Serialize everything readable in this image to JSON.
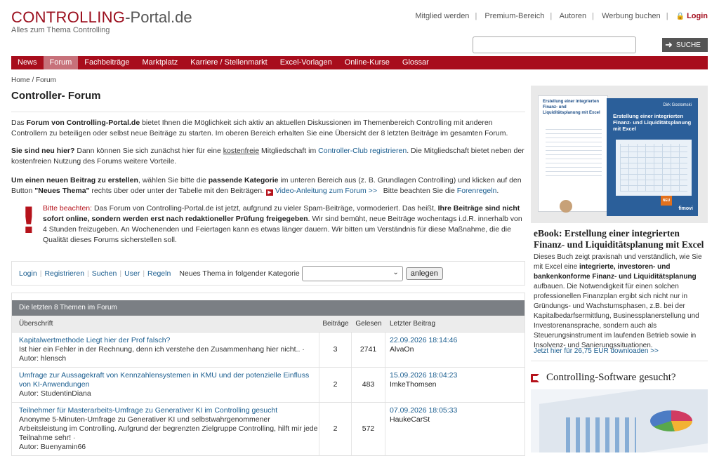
{
  "header": {
    "brand": "CONTROLLING",
    "brand_suffix": "-Portal.de",
    "tagline": "Alles zum Thema Controlling",
    "top_links": [
      "Mitglied werden",
      "Premium-Bereich",
      "Autoren",
      "Werbung buchen"
    ],
    "login_label": "Login",
    "search_value": "",
    "search_button": "SUCHE"
  },
  "nav": {
    "items": [
      "News",
      "Forum",
      "Fachbeiträge",
      "Marktplatz",
      "Karriere / Stellenmarkt",
      "Excel-Vorlagen",
      "Online-Kurse",
      "Glossar"
    ],
    "active": "Forum"
  },
  "breadcrumb": "Home / Forum",
  "page_title": "Controller- Forum",
  "intro": {
    "p1_a": "Das ",
    "p1_b": "Forum von Controlling-Portal.de",
    "p1_c": " bietet Ihnen die Möglichkeit sich aktiv an aktuellen Diskussionen im Themenbereich Controlling mit anderen Controllern zu beteiligen oder selbst neue Beiträge zu starten. Im oberen Bereich erhalten Sie eine Übersicht der 8 letzten Beiträge im gesamten Forum.",
    "p2_a": "Sie sind neu hier?",
    "p2_b": " Dann können Sie sich zunächst hier für eine ",
    "p2_c": "kostenfreie",
    "p2_d": " Mitgliedschaft im ",
    "p2_e": "Controller-Club registrieren",
    "p2_f": ". Die Mitgliedschaft bietet neben der kostenfreien Nutzung des Forums weitere Vorteile.",
    "p3_a": "Um einen neuen Beitrag zu erstellen",
    "p3_b": ", wählen Sie bitte die ",
    "p3_c": "passende Kategorie",
    "p3_d": " im unteren Bereich aus (z. B. Grundlagen Controlling) und klicken auf den Button ",
    "p3_e": "\"Neues Thema\"",
    "p3_f": " rechts über oder unter der Tabelle mit den Beiträgen. ",
    "p3_video": "Video-Anleitung zum Forum >>",
    "p3_g": "   Bitte beachten Sie die ",
    "p3_rules": "Forenregeln",
    "p3_h": "."
  },
  "warning": {
    "label": "Bitte beachten:",
    "a": " Das Forum von Controlling-Portal.de ist jetzt, aufgrund zu vieler Spam-Beiträge, vormoderiert. Das heißt, ",
    "b": "Ihre Beiträge sind nicht sofort online, sondern werden erst nach redaktioneller Prüfung freigegeben",
    "c": ". Wir sind bemüht, neue Beiträge wochentags i.d.R. innerhalb von 4 Stunden freizugeben. An Wochenenden und Feiertagen kann es etwas länger dauern. Wir bitten um Verständnis für diese Maßnahme, die die Qualität dieses Forums sicherstellen soll."
  },
  "actions": {
    "links": [
      "Login",
      "Registrieren",
      "Suchen",
      "User",
      "Regeln"
    ],
    "category_label": "Neues Thema in folgender Kategorie",
    "category_value": "",
    "create_button": "anlegen"
  },
  "topics": {
    "heading": "Die letzten 8 Themen im Forum",
    "columns": [
      "Überschrift",
      "Beiträge",
      "Gelesen",
      "Letzter Beitrag"
    ],
    "rows": [
      {
        "title": "Kapitalwertmethode Liegt hier der Prof falsch?",
        "excerpt": "Ist hier ein Fehler in der Rechnung, denn ich verstehe den Zusammenhang hier nicht.. ·",
        "author": "Autor: hlensch",
        "posts": "3",
        "views": "2741",
        "date": "22.09.2026 18:14:46",
        "user": "AlvaOn"
      },
      {
        "title": "Umfrage zur Aussagekraft von Kennzahlensystemen in KMU und der potenzielle Einfluss von KI-Anwendungen",
        "excerpt": "",
        "author": "Autor: StudentinDiana",
        "posts": "2",
        "views": "483",
        "date": "15.09.2026 18:04:23",
        "user": "ImkeThomsen"
      },
      {
        "title": "Teilnehmer für Masterarbeits-Umfrage zu Generativer KI im Controlling gesucht",
        "excerpt": "Anonyme 5-Minuten-Umfrage zu Generativer KI und selbstwahrgenommener Arbeitsleistung im Controlling. Aufgrund der begrenzten Zielgruppe Controlling, hilft mir jede Teilnahme sehr! ·",
        "author": "Autor: Buenyamin66",
        "posts": "2",
        "views": "572",
        "date": "07.09.2026 18:05:33",
        "user": "HaukeCarSt"
      }
    ]
  },
  "sidebar": {
    "book_back_title": "Erstellung einer integrierten Finanz- und Liquiditätsplanung mit Excel",
    "book_author": "Dirk Gostomski",
    "book_front_title": "Erstellung einer integrierten Finanz- und Liquiditätsplanung mit Excel",
    "book_badge": "NEU",
    "book_publisher": "fimovi",
    "ebook_title": "eBook: Erstellung einer integrierten Finanz- und Liquiditätsplanung mit Excel",
    "ebook_text_a": "Dieses Buch zeigt praxisnah und verständlich, wie Sie mit Excel eine ",
    "ebook_text_b": "integrierte, investoren- und bankenkonforme Finanz- und Liquiditätsplanung",
    "ebook_text_c": " aufbauen. Die Notwendigkeit für einen solchen professionellen Finanzplan ergibt sich nicht nur in Gründungs- und Wachstumsphasen, z.B. bei der Kapitalbedarfsermittlung, Businessplanerstellung und Investorenansprache, sondern auch als Steuerungsinstrument im laufenden Betrieb sowie in Insolvenz- und Sanierungssituationen.",
    "ebook_link": "Jetzt hier für 26,75 EUR downloaden >>",
    "software_title": "Controlling-Software gesucht?"
  }
}
